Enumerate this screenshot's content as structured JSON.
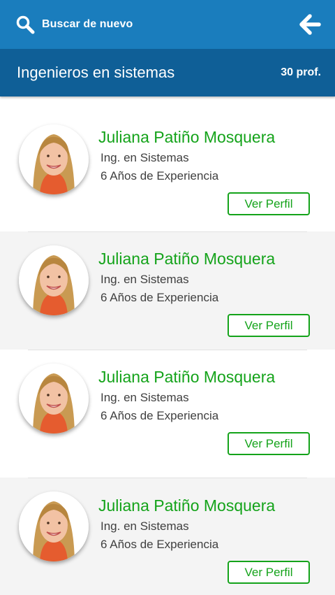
{
  "topbar": {
    "search_icon": "search-icon",
    "search_label": "Buscar de nuevo",
    "back_icon": "arrow-left-icon",
    "color": "#1a7dbd"
  },
  "header": {
    "title": "Ingenieros en sistemas",
    "count": "30 prof.",
    "color": "#0f5f97"
  },
  "accent_color": "#14a31a",
  "professionals": [
    {
      "name": "Juliana Patiño Mosquera",
      "title": "Ing. en Sistemas",
      "experience": "6 Años de Experiencia",
      "button": "Ver Perfil"
    },
    {
      "name": "Juliana Patiño Mosquera",
      "title": "Ing. en Sistemas",
      "experience": "6 Años de Experiencia",
      "button": "Ver Perfil"
    },
    {
      "name": "Juliana Patiño Mosquera",
      "title": "Ing. en Sistemas",
      "experience": "6 Años de Experiencia",
      "button": "Ver Perfil"
    },
    {
      "name": "Juliana Patiño Mosquera",
      "title": "Ing. en Sistemas",
      "experience": "6 Años de Experiencia",
      "button": "Ver Perfil"
    }
  ]
}
